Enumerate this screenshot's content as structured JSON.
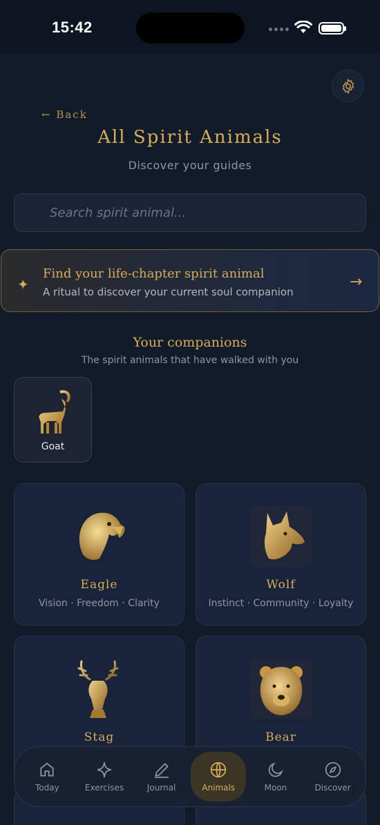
{
  "status": {
    "time": "15:42"
  },
  "header": {
    "back": "← Back",
    "title": "All Spirit Animals",
    "subtitle": "Discover your guides"
  },
  "search": {
    "placeholder": "Search spirit animal..."
  },
  "ritual": {
    "title": "Find your life-chapter spirit animal",
    "subtitle": "A ritual to discover your current soul companion",
    "icon": "sparkle-icon"
  },
  "companions": {
    "title": "Your companions",
    "subtitle": "The spirit animals that have walked with you",
    "items": [
      {
        "name": "Goat"
      }
    ]
  },
  "animals": [
    {
      "name": "Eagle",
      "traits": "Vision · Freedom · Clarity"
    },
    {
      "name": "Wolf",
      "traits": "Instinct · Community · Loyalty"
    },
    {
      "name": "Stag",
      "traits": ""
    },
    {
      "name": "Bear",
      "traits": ""
    }
  ],
  "tabs": [
    {
      "label": "Today",
      "icon": "home-icon",
      "active": false
    },
    {
      "label": "Exercises",
      "icon": "sparkle-icon",
      "active": false
    },
    {
      "label": "Journal",
      "icon": "pen-icon",
      "active": false
    },
    {
      "label": "Animals",
      "icon": "globe-icon",
      "active": true
    },
    {
      "label": "Moon",
      "icon": "moon-icon",
      "active": false
    },
    {
      "label": "Discover",
      "icon": "compass-icon",
      "active": false
    }
  ],
  "colors": {
    "background": "#121b2a",
    "accent": "#d9ad58",
    "card": "#19233a"
  }
}
